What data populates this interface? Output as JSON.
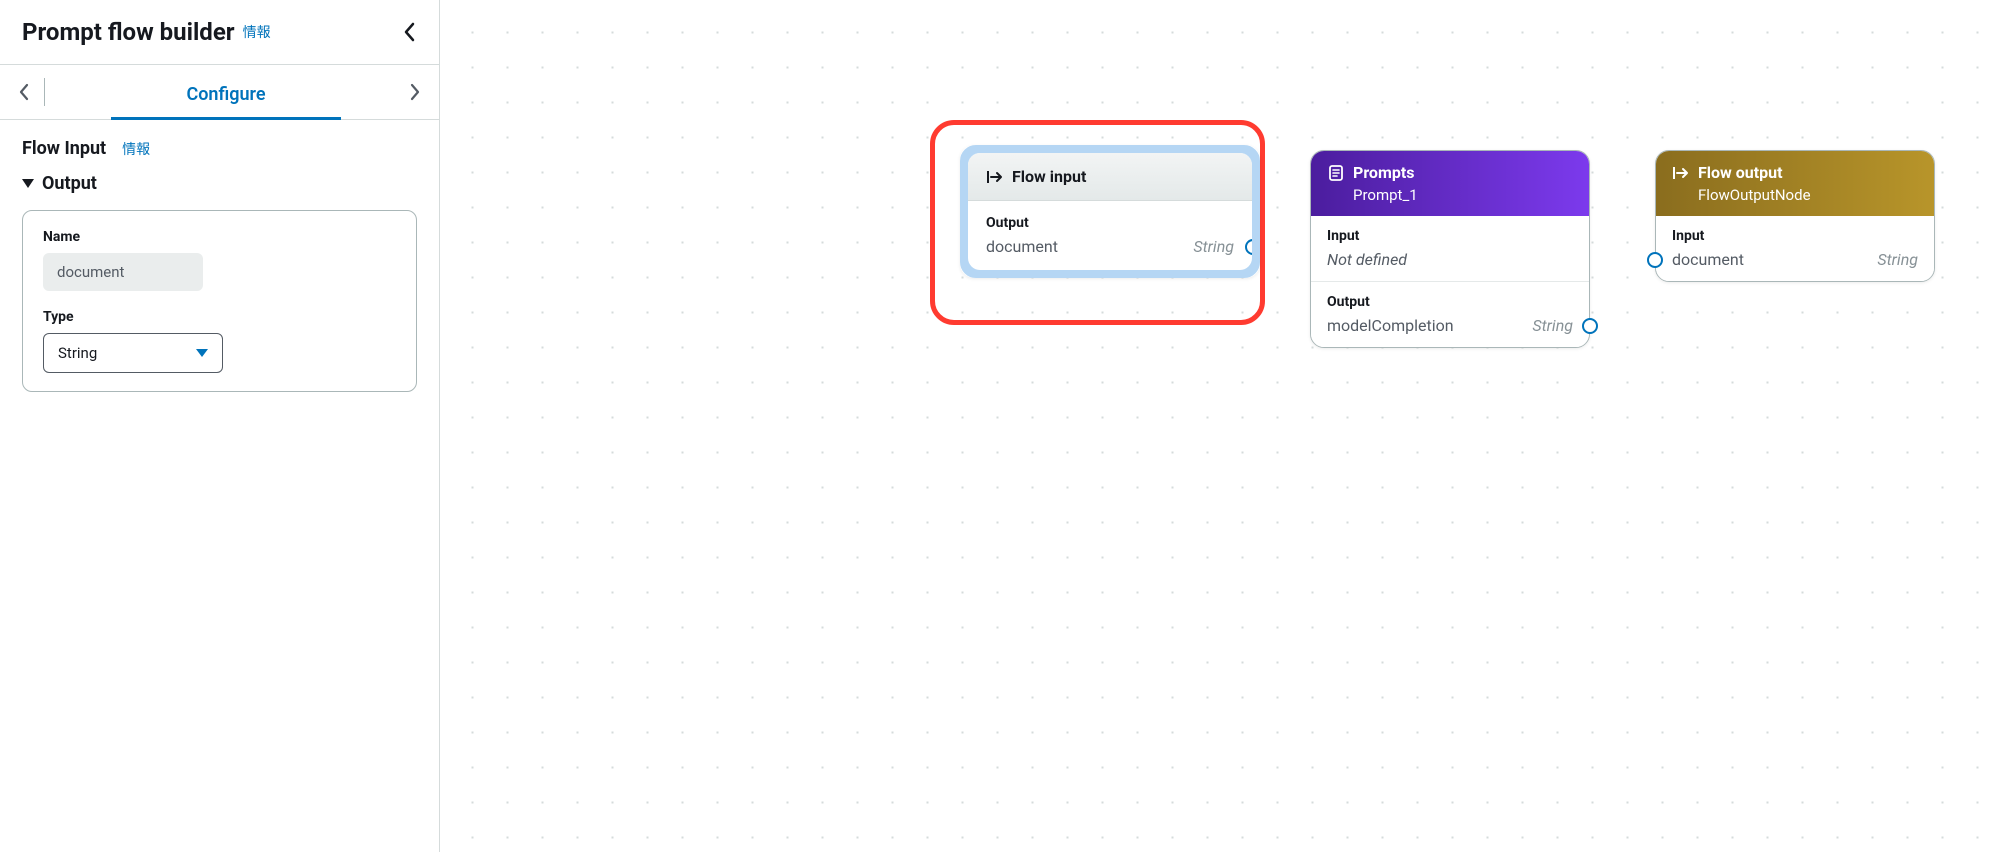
{
  "sidebar": {
    "title": "Prompt flow builder",
    "info_link": "情報",
    "tab_configure": "Configure",
    "section": {
      "title": "Flow Input",
      "info_link": "情報",
      "output_label": "Output",
      "name_label": "Name",
      "name_value": "document",
      "type_label": "Type",
      "type_value": "String"
    }
  },
  "nodes": {
    "flow_input": {
      "title": "Flow input",
      "output_label": "Output",
      "output_name": "document",
      "output_type": "String"
    },
    "prompts": {
      "title": "Prompts",
      "subtitle": "Prompt_1",
      "input_label": "Input",
      "input_name": "Not defined",
      "output_label": "Output",
      "output_name": "modelCompletion",
      "output_type": "String"
    },
    "flow_output": {
      "title": "Flow output",
      "subtitle": "FlowOutputNode",
      "input_label": "Input",
      "input_name": "document",
      "input_type": "String"
    }
  }
}
